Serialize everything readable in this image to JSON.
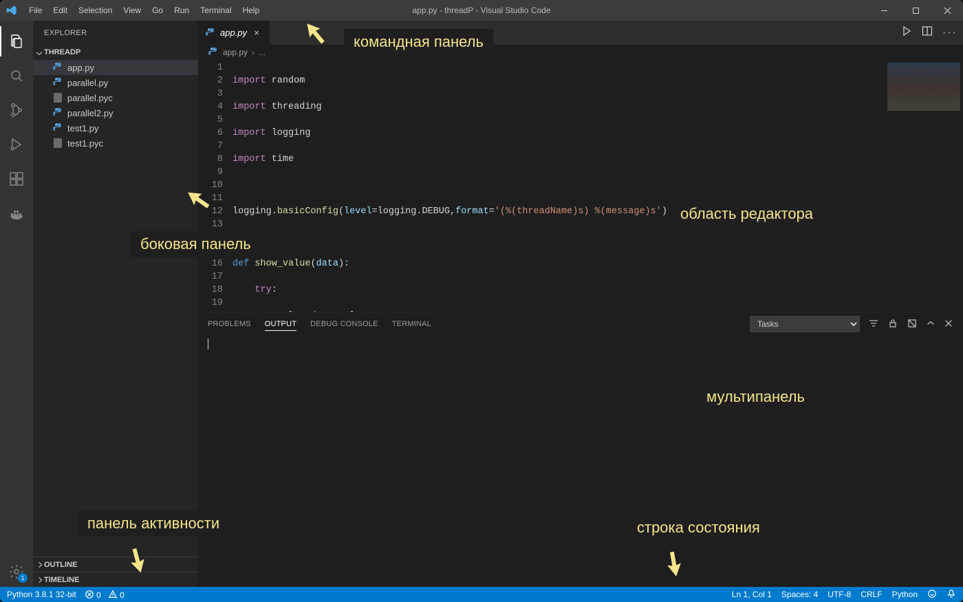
{
  "window": {
    "title": "app.py - threadP - Visual Studio Code"
  },
  "menu": [
    "File",
    "Edit",
    "Selection",
    "View",
    "Go",
    "Run",
    "Terminal",
    "Help"
  ],
  "activity": {
    "settings_badge": "1"
  },
  "sidebar": {
    "title": "EXPLORER",
    "folder": "THREADP",
    "files": [
      {
        "name": "app.py",
        "active": true,
        "type": "py"
      },
      {
        "name": "parallel.py",
        "active": false,
        "type": "py"
      },
      {
        "name": "parallel.pyc",
        "active": false,
        "type": "pyc"
      },
      {
        "name": "parallel2.py",
        "active": false,
        "type": "py"
      },
      {
        "name": "test1.py",
        "active": false,
        "type": "py"
      },
      {
        "name": "test1.pyc",
        "active": false,
        "type": "pyc"
      }
    ],
    "sections": [
      "OUTLINE",
      "TIMELINE"
    ]
  },
  "editor": {
    "tab": {
      "name": "app.py"
    },
    "breadcrumb": {
      "file": "app.py",
      "tail": "..."
    },
    "lines": 19
  },
  "panel": {
    "tabs": [
      "PROBLEMS",
      "OUTPUT",
      "DEBUG CONSOLE",
      "TERMINAL"
    ],
    "active": 1,
    "filter": "Tasks"
  },
  "status": {
    "python": "Python 3.8.1 32-bit",
    "errors": "0",
    "warnings": "0",
    "ln": "Ln 1, Col 1",
    "spaces": "Spaces: 4",
    "encoding": "UTF-8",
    "eol": "CRLF",
    "lang": "Python"
  },
  "annotations": {
    "command_panel": "командная панель",
    "side_panel": "боковая панель",
    "editor_area": "область редактора",
    "multi_panel": "мультипанель",
    "activity_panel": "панель активности",
    "status_line": "строка состояния"
  }
}
